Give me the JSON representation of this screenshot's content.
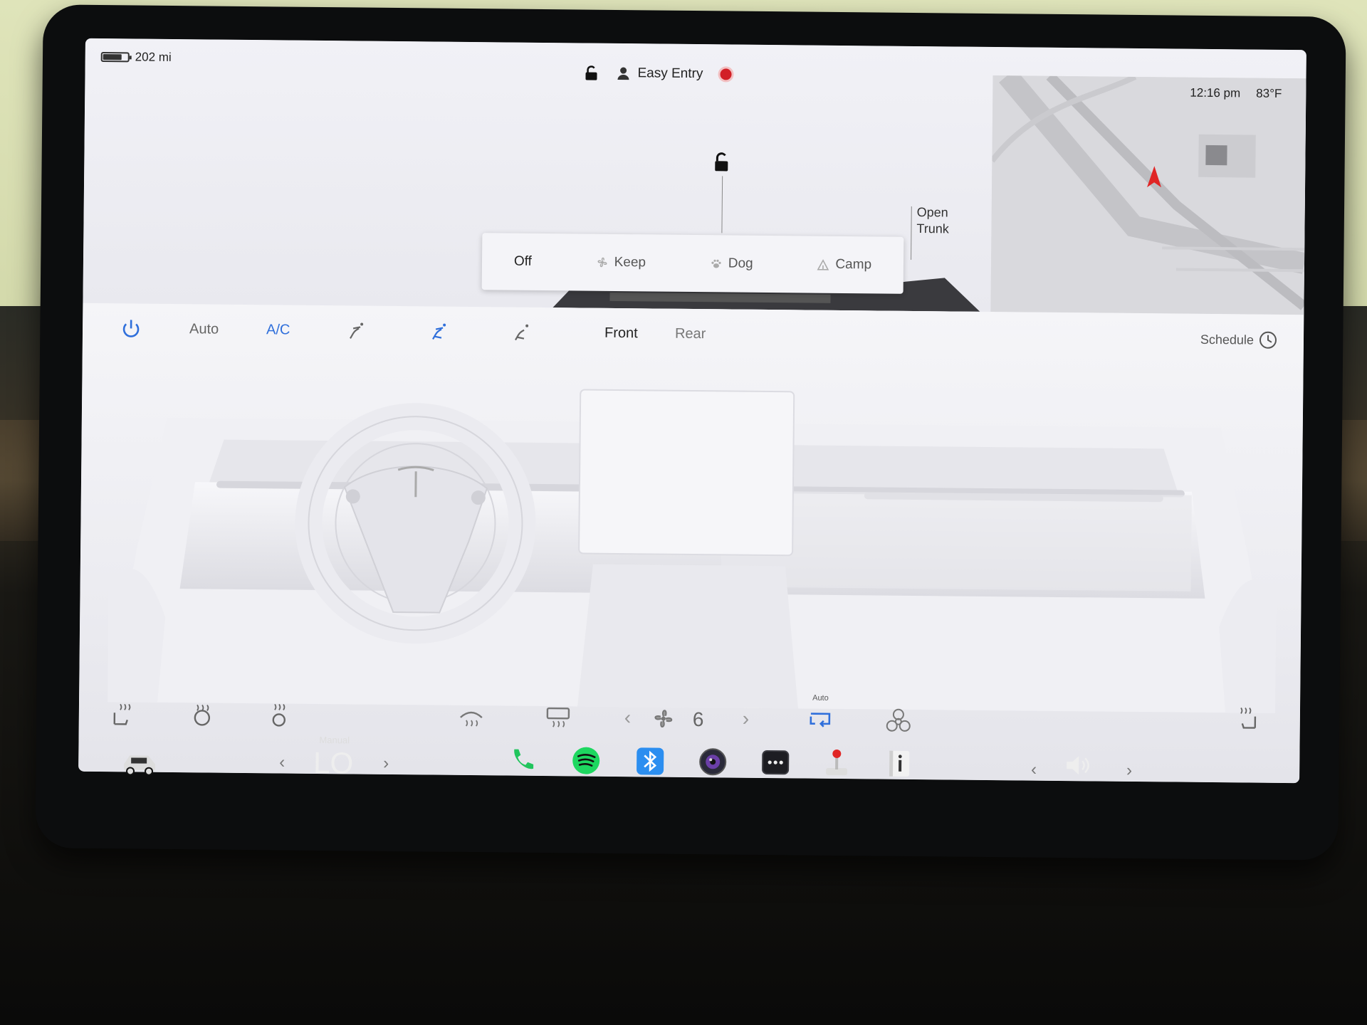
{
  "status": {
    "range": "202 mi",
    "battery_fraction": 0.75,
    "profile": "Easy Entry",
    "time": "12:16 pm",
    "outside_temp": "83°F",
    "recording_color": "#d21f26"
  },
  "vehicle": {
    "trunk_label_line1": "Open",
    "trunk_label_line2": "Trunk",
    "frunk_icon": "unlock-icon"
  },
  "climate_mode_menu": {
    "options": [
      {
        "label": "Off",
        "icon": "",
        "selected": true
      },
      {
        "label": "Keep",
        "icon": "fan-icon",
        "selected": false
      },
      {
        "label": "Dog",
        "icon": "paw-icon",
        "selected": false
      },
      {
        "label": "Camp",
        "icon": "tent-icon",
        "selected": false
      }
    ]
  },
  "climate_controls": {
    "power_icon": "power-icon",
    "auto_label": "Auto",
    "ac_label": "A/C",
    "airflow_icons": [
      "airflow-face-icon",
      "airflow-face-feet-icon",
      "airflow-feet-icon"
    ],
    "zone_front": "Front",
    "zone_rear": "Rear",
    "schedule_label": "Schedule",
    "accent_color": "#2f6fdb"
  },
  "climate_bottom": {
    "fan_speed": "6",
    "recirculate_label": "Auto",
    "icons": [
      "seat-heater-left-icon",
      "steering-heater-icon",
      "cabin-overheat-icon",
      "front-defrost-icon",
      "rear-defrost-icon",
      "fan-icon",
      "recirculate-icon",
      "biohazard-icon",
      "seat-heater-right-icon"
    ]
  },
  "taskbar": {
    "temp_mode": "Manual",
    "temperature": "LO",
    "apps": [
      "phone-icon",
      "spotify-icon",
      "bluetooth-icon",
      "camera-icon",
      "more-icon",
      "toybox-icon",
      "manual-icon"
    ],
    "volume_icon": "volume-icon"
  }
}
